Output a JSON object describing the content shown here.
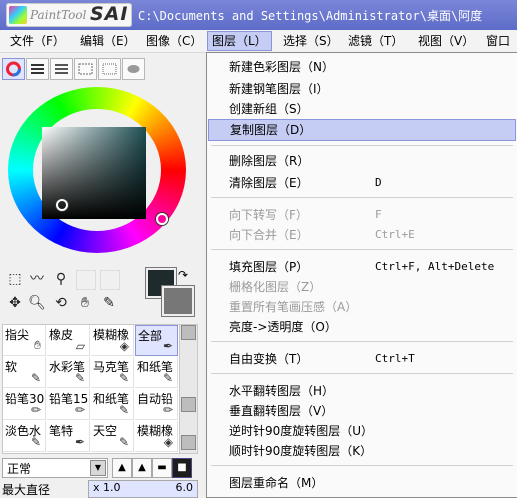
{
  "titlebar": {
    "logo_text": "PaintTool SAI",
    "path": "C:\\Documents and Settings\\Administrator\\桌面\\阿度"
  },
  "menubar": [
    {
      "label": "文件（F）",
      "active": false
    },
    {
      "label": "编辑（E）",
      "active": false
    },
    {
      "label": "图像（C）",
      "active": false
    },
    {
      "label": "图层（L）",
      "active": true
    },
    {
      "label": "选择（S）",
      "active": false
    },
    {
      "label": "滤镜（T）",
      "active": false
    },
    {
      "label": "视图（V）",
      "active": false
    },
    {
      "label": "窗口",
      "active": false
    }
  ],
  "layer_menu": [
    {
      "label": "新建色彩图层（N）",
      "shortcut": "",
      "disabled": false,
      "highlighted": false
    },
    {
      "label": "新建钢笔图层（I）",
      "shortcut": "",
      "disabled": false,
      "highlighted": false
    },
    {
      "label": "创建新组（S）",
      "shortcut": "",
      "disabled": false,
      "highlighted": false
    },
    {
      "label": "复制图层（D）",
      "shortcut": "",
      "disabled": false,
      "highlighted": true
    },
    {
      "sep": true
    },
    {
      "label": "删除图层（R）",
      "shortcut": "",
      "disabled": false,
      "highlighted": false
    },
    {
      "label": "清除图层（E）",
      "shortcut": "D",
      "disabled": false,
      "highlighted": false
    },
    {
      "sep": true
    },
    {
      "label": "向下转写（F）",
      "shortcut": "F",
      "disabled": true,
      "highlighted": false
    },
    {
      "label": "向下合并（E）",
      "shortcut": "Ctrl+E",
      "disabled": true,
      "highlighted": false
    },
    {
      "sep": true
    },
    {
      "label": "填充图层（P）",
      "shortcut": "Ctrl+F, Alt+Delete",
      "disabled": false,
      "highlighted": false
    },
    {
      "label": "栅格化图层（Z）",
      "shortcut": "",
      "disabled": true,
      "highlighted": false
    },
    {
      "label": "重置所有笔画压感（A）",
      "shortcut": "",
      "disabled": true,
      "highlighted": false
    },
    {
      "label": "亮度->透明度（O）",
      "shortcut": "",
      "disabled": false,
      "highlighted": false
    },
    {
      "sep": true
    },
    {
      "label": "自由变换（T）",
      "shortcut": "Ctrl+T",
      "disabled": false,
      "highlighted": false
    },
    {
      "sep": true
    },
    {
      "label": "水平翻转图层（H）",
      "shortcut": "",
      "disabled": false,
      "highlighted": false
    },
    {
      "label": "垂直翻转图层（V）",
      "shortcut": "",
      "disabled": false,
      "highlighted": false
    },
    {
      "label": "逆时针90度旋转图层（U）",
      "shortcut": "",
      "disabled": false,
      "highlighted": false
    },
    {
      "label": "顺时针90度旋转图层（K）",
      "shortcut": "",
      "disabled": false,
      "highlighted": false
    },
    {
      "sep": true
    },
    {
      "label": "图层重命名（M）",
      "shortcut": "",
      "disabled": false,
      "highlighted": false
    }
  ],
  "color": {
    "foreground": "#1e2a2c",
    "background": "#777777",
    "hue": "#1f5054"
  },
  "brushes": [
    {
      "label": "指尖",
      "icon": "finger-tip-icon",
      "selected": false
    },
    {
      "label": "橡皮",
      "icon": "eraser-icon",
      "selected": false
    },
    {
      "label": "模糊橡",
      "icon": "blur-eraser-icon",
      "selected": false
    },
    {
      "label": "全部",
      "icon": "pen-icon",
      "selected": true
    },
    {
      "label": "软",
      "icon": "soft-brush-icon",
      "selected": false
    },
    {
      "label": "水彩笔",
      "icon": "watercolor-icon",
      "selected": false
    },
    {
      "label": "马克笔",
      "icon": "marker-icon",
      "selected": false
    },
    {
      "label": "和纸笔",
      "icon": "washi-brush-icon",
      "selected": false
    },
    {
      "label": "铅笔30",
      "icon": "pencil-icon",
      "selected": false
    },
    {
      "label": "铅笔15",
      "icon": "pencil-icon",
      "selected": false
    },
    {
      "label": "和纸笔",
      "icon": "washi-brush-icon",
      "selected": false
    },
    {
      "label": "自动铅",
      "icon": "auto-pencil-icon",
      "selected": false
    },
    {
      "label": "淡色水",
      "icon": "light-water-icon",
      "selected": false
    },
    {
      "label": "笔特",
      "icon": "pen-icon",
      "selected": false
    },
    {
      "label": "天空",
      "icon": "sky-brush-icon",
      "selected": false
    },
    {
      "label": "模糊橡",
      "icon": "blur-eraser-icon",
      "selected": false
    }
  ],
  "blend_mode": "正常",
  "max_size": {
    "label": "最大直径",
    "multiplier": "x 1.0",
    "value": "6.0"
  }
}
